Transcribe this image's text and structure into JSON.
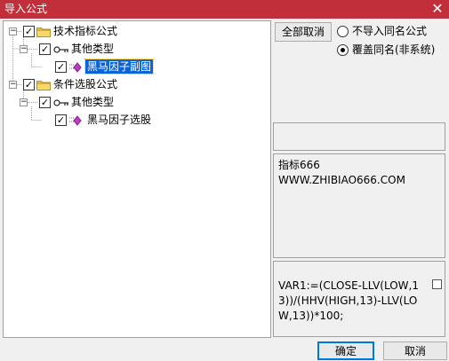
{
  "window": {
    "title": "导入公式",
    "close_label": "✕"
  },
  "tree": [
    {
      "label": "技术指标公式",
      "checked": true,
      "expander": "−",
      "icon": "folder-icon"
    },
    {
      "label": "其他类型",
      "checked": true,
      "expander": "−",
      "icon": "key-icon"
    },
    {
      "label": "黑马因子副图",
      "checked": true,
      "icon": "formula-diamond-icon",
      "selected": true
    },
    {
      "label": "条件选股公式",
      "checked": true,
      "expander": "−",
      "icon": "folder-icon"
    },
    {
      "label": "其他类型",
      "checked": true,
      "expander": "−",
      "icon": "key-icon"
    },
    {
      "label": "黑马因子选股",
      "checked": true,
      "icon": "formula-diamond-icon"
    }
  ],
  "controls": {
    "cancel_all_label": "全部取消",
    "option_skip_label": "不导入同名公式",
    "option_overwrite_label": "覆盖同名(非系统)",
    "selected_option": "overwrite"
  },
  "description": {
    "text": "指标666\nWWW.ZHIBIAO666.COM"
  },
  "formula": {
    "text": "VAR1:=(CLOSE-LLV(LOW,13))/(HHV(HIGH,13)-LLV(LOW,13))*100;",
    "checkbox_checked": false
  },
  "footer": {
    "ok_label": "确定",
    "cancel_label": "取消"
  },
  "colors": {
    "titlebar": "#c1303a",
    "selection": "#0a64d8",
    "folder": "#f2c94c",
    "diamond": "#c03ac8"
  }
}
